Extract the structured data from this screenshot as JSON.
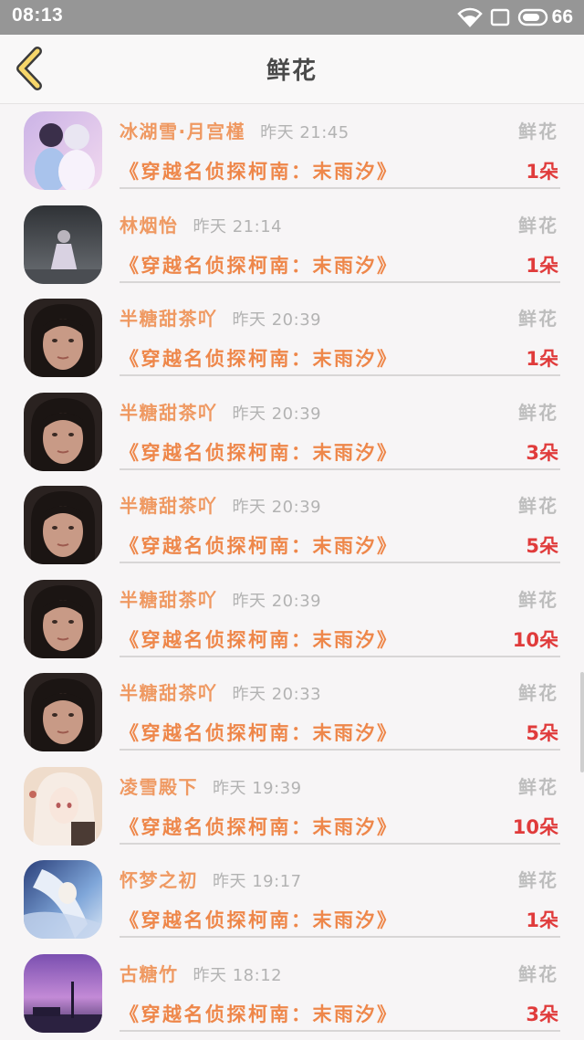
{
  "status_bar": {
    "time": "08:13",
    "battery_level": "66",
    "icons": [
      "wifi-icon",
      "sim-icon",
      "battery-icon"
    ]
  },
  "header": {
    "title": "鲜花",
    "back_icon": "chevron-left-icon"
  },
  "colors": {
    "name": "#ef9962",
    "book": "#ee874a",
    "count": "#e03b3b",
    "muted": "#b3b3b3",
    "back_icon_fill": "#f6d66a"
  },
  "records": [
    {
      "name": "冰湖雪·月宫槿",
      "time": "昨天 21:45",
      "type": "鲜花",
      "book": "《穿越名侦探柯南：末雨汐》",
      "count": "1朵"
    },
    {
      "name": "林烟怡",
      "time": "昨天 21:14",
      "type": "鲜花",
      "book": "《穿越名侦探柯南：末雨汐》",
      "count": "1朵"
    },
    {
      "name": "半糖甜茶吖",
      "time": "昨天 20:39",
      "type": "鲜花",
      "book": "《穿越名侦探柯南：末雨汐》",
      "count": "1朵"
    },
    {
      "name": "半糖甜茶吖",
      "time": "昨天 20:39",
      "type": "鲜花",
      "book": "《穿越名侦探柯南：末雨汐》",
      "count": "3朵"
    },
    {
      "name": "半糖甜茶吖",
      "time": "昨天 20:39",
      "type": "鲜花",
      "book": "《穿越名侦探柯南：末雨汐》",
      "count": "5朵"
    },
    {
      "name": "半糖甜茶吖",
      "time": "昨天 20:39",
      "type": "鲜花",
      "book": "《穿越名侦探柯南：末雨汐》",
      "count": "10朵"
    },
    {
      "name": "半糖甜茶吖",
      "time": "昨天 20:33",
      "type": "鲜花",
      "book": "《穿越名侦探柯南：末雨汐》",
      "count": "5朵"
    },
    {
      "name": "凌雪殿下",
      "time": "昨天 19:39",
      "type": "鲜花",
      "book": "《穿越名侦探柯南：末雨汐》",
      "count": "10朵"
    },
    {
      "name": "怀梦之初",
      "time": "昨天 19:17",
      "type": "鲜花",
      "book": "《穿越名侦探柯南：末雨汐》",
      "count": "1朵"
    },
    {
      "name": "古糖竹",
      "time": "昨天 18:12",
      "type": "鲜花",
      "book": "《穿越名侦探柯南：末雨汐》",
      "count": "3朵"
    }
  ]
}
